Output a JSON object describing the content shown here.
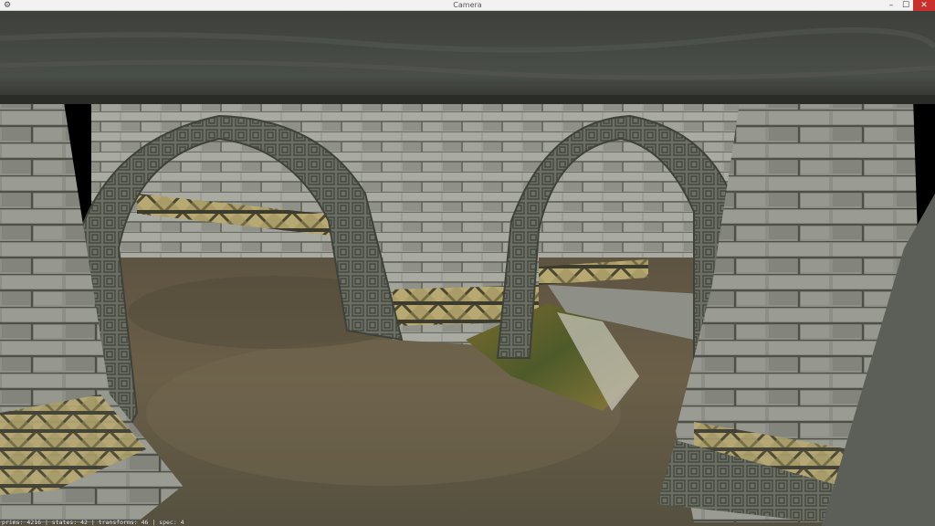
{
  "window": {
    "title": "Camera",
    "minimize_label": "–",
    "maximize_label": "☐",
    "close_label": "✕",
    "app_icon": "gear-icon"
  },
  "viewport": {
    "scene": "game-3d-viewport"
  },
  "stats": {
    "text": "prims: 4216 | states: 42 | transforms: 46 | spec: 4"
  }
}
